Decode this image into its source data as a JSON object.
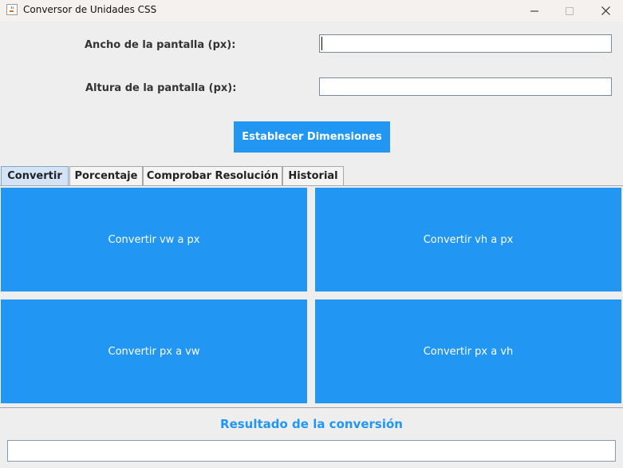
{
  "window": {
    "title": "Conversor de Unidades CSS",
    "icon": "java-cup-icon",
    "controls": [
      "minimize-icon",
      "maximize-icon",
      "close-icon"
    ]
  },
  "form": {
    "width_label": "Ancho de la pantalla (px):",
    "width_value": "",
    "height_label": "Altura de la pantalla (px):",
    "height_value": "",
    "set_button": "Establecer Dimensiones"
  },
  "tabs": [
    {
      "label": "Convertir",
      "active": true
    },
    {
      "label": "Porcentaje",
      "active": false
    },
    {
      "label": "Comprobar Resolución",
      "active": false
    },
    {
      "label": "Historial",
      "active": false
    }
  ],
  "convert": {
    "vw_to_px": "Convertir vw a px",
    "vh_to_px": "Convertir vh a px",
    "px_to_vw": "Convertir px a vw",
    "px_to_vh": "Convertir px a vh"
  },
  "result": {
    "title": "Resultado de la conversión",
    "value": ""
  },
  "colors": {
    "accent": "#2196f3",
    "background": "#eeeeee",
    "active_tab": "#d3e4f7"
  }
}
